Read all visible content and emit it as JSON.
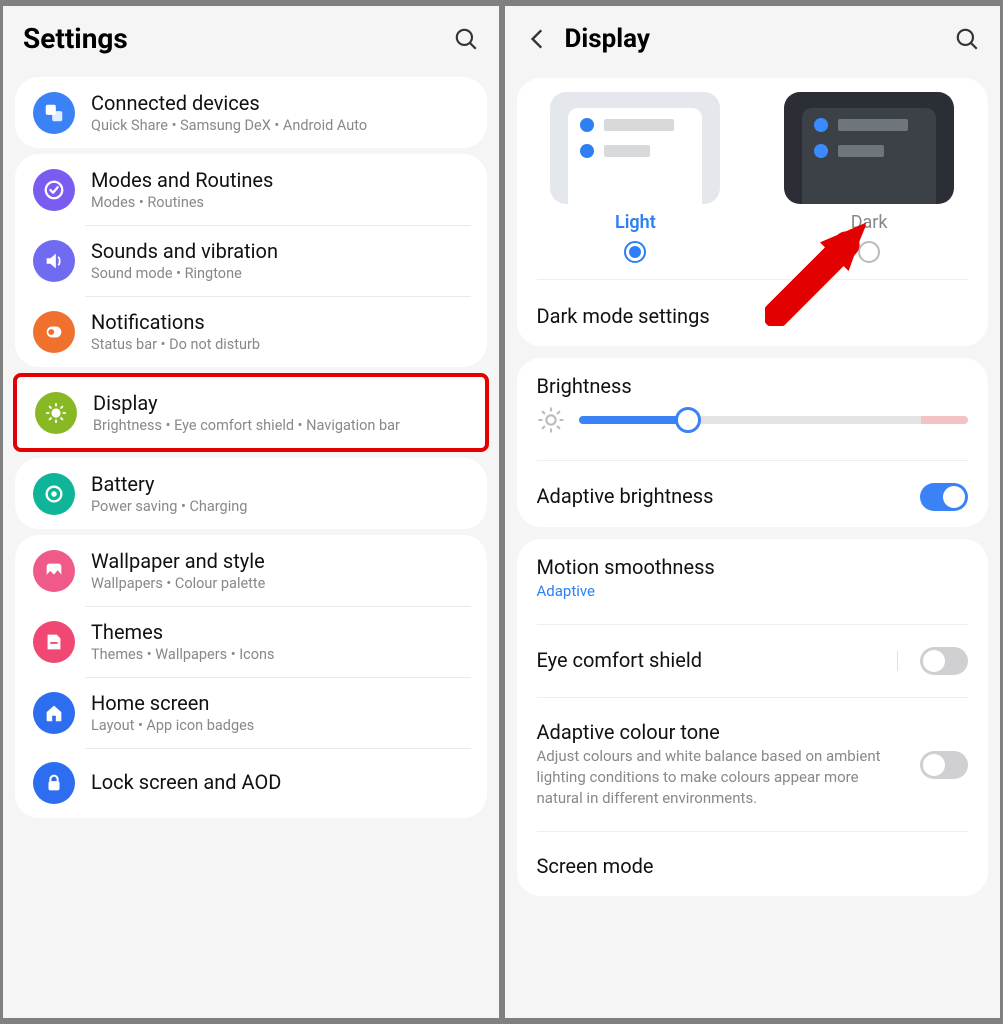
{
  "left": {
    "title": "Settings",
    "groups": [
      [
        {
          "icon": "connected",
          "color": "#3b82f6",
          "title": "Connected devices",
          "sub": "Quick Share  •  Samsung DeX  •  Android Auto"
        }
      ],
      [
        {
          "icon": "modes",
          "color": "#7a5cf0",
          "title": "Modes and Routines",
          "sub": "Modes  •  Routines"
        },
        {
          "icon": "sound",
          "color": "#6f6cf2",
          "title": "Sounds and vibration",
          "sub": "Sound mode  •  Ringtone"
        },
        {
          "icon": "notif",
          "color": "#f0702e",
          "title": "Notifications",
          "sub": "Status bar  •  Do not disturb"
        }
      ],
      [
        {
          "icon": "display",
          "color": "#88b824",
          "title": "Display",
          "sub": "Brightness  •  Eye comfort shield  •  Navigation bar",
          "highlight": true
        },
        {
          "icon": "battery",
          "color": "#0fb599",
          "title": "Battery",
          "sub": "Power saving  •  Charging"
        }
      ],
      [
        {
          "icon": "wallpaper",
          "color": "#ef5a88",
          "title": "Wallpaper and style",
          "sub": "Wallpapers  •  Colour palette"
        },
        {
          "icon": "themes",
          "color": "#f04773",
          "title": "Themes",
          "sub": "Themes  •  Wallpapers  •  Icons"
        },
        {
          "icon": "home",
          "color": "#2d6df0",
          "title": "Home screen",
          "sub": "Layout  •  App icon badges"
        },
        {
          "icon": "lock",
          "color": "#2d6df0",
          "title": "Lock screen and AOD",
          "sub": ""
        }
      ]
    ]
  },
  "right": {
    "title": "Display",
    "theme": {
      "light": "Light",
      "dark": "Dark",
      "selected": "light"
    },
    "darkmode": "Dark mode settings",
    "brightness_label": "Brightness",
    "adaptive_brightness": "Adaptive brightness",
    "motion": {
      "title": "Motion smoothness",
      "value": "Adaptive"
    },
    "eyecomfort": "Eye comfort shield",
    "colourtone": {
      "title": "Adaptive colour tone",
      "sub": "Adjust colours and white balance based on ambient lighting conditions to make colours appear more natural in different environments."
    },
    "screenmode": "Screen mode"
  }
}
